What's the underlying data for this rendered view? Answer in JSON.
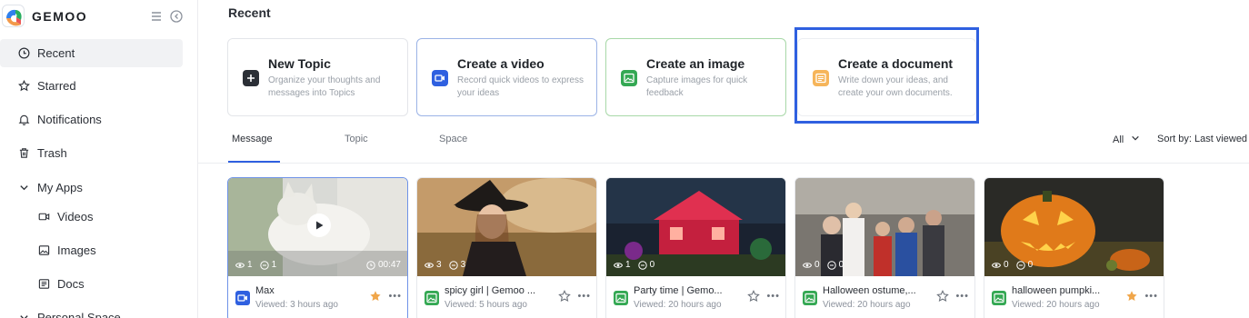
{
  "brand": {
    "name": "GEMOO"
  },
  "sidebar": {
    "items": [
      {
        "label": "Recent",
        "icon": "clock-icon",
        "active": true
      },
      {
        "label": "Starred",
        "icon": "star-icon"
      },
      {
        "label": "Notifications",
        "icon": "bell-icon"
      },
      {
        "label": "Trash",
        "icon": "trash-icon"
      }
    ],
    "my_apps": {
      "label": "My Apps",
      "items": [
        {
          "label": "Videos",
          "icon": "video-icon"
        },
        {
          "label": "Images",
          "icon": "image-icon"
        },
        {
          "label": "Docs",
          "icon": "doc-icon"
        }
      ]
    },
    "personal_space_label": "Personal Space"
  },
  "main": {
    "title": "Recent",
    "actions": [
      {
        "title": "New Topic",
        "desc": "Organize your thoughts and messages into Topics",
        "color": "#2b2f36"
      },
      {
        "title": "Create a video",
        "desc": "Record quick videos to express your ideas",
        "color": "#2f60e0"
      },
      {
        "title": "Create an image",
        "desc": "Capture images for quick feedback",
        "color": "#34a853"
      },
      {
        "title": "Create a document",
        "desc": "Write down your ideas, and create your own documents.",
        "color": "#f0a64a"
      }
    ],
    "tabs": [
      {
        "label": "Message",
        "active": true
      },
      {
        "label": "Topic"
      },
      {
        "label": "Space"
      }
    ],
    "filter_label": "All",
    "sort_label": "Sort by: Last viewed"
  },
  "cards": [
    {
      "title": "Max",
      "meta": "Viewed: 3 hours ago",
      "views": "1",
      "comments": "1",
      "duration": "00:47",
      "type": "video",
      "starred": true
    },
    {
      "title": "spicy girl | Gemoo ...",
      "meta": "Viewed: 5 hours ago",
      "views": "3",
      "comments": "3",
      "type": "image",
      "starred": false
    },
    {
      "title": "Party time | Gemo...",
      "meta": "Viewed: 20 hours ago",
      "views": "1",
      "comments": "0",
      "type": "image",
      "starred": false
    },
    {
      "title": "Halloween ostume,...",
      "meta": "Viewed: 20 hours ago",
      "views": "0",
      "comments": "0",
      "type": "image",
      "starred": false
    },
    {
      "title": "halloween pumpki...",
      "meta": "Viewed: 20 hours ago",
      "views": "0",
      "comments": "0",
      "type": "image",
      "starred": true
    }
  ],
  "colors": {
    "accent": "#2f60e0",
    "star_active": "#f0a64a",
    "image_green": "#34a853"
  }
}
